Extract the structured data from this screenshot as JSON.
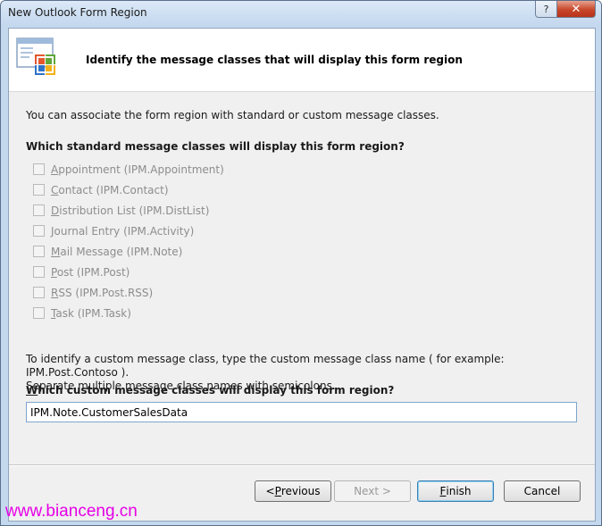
{
  "window": {
    "title": "New Outlook Form Region",
    "help_label": "?",
    "close_label": "✕"
  },
  "header": {
    "title": "Identify the message classes that will display this form region",
    "icon": "form-region-wizard-icon"
  },
  "intro_text": "You can associate the form region with standard or custom message classes.",
  "standard": {
    "question": "Which standard message classes will display this form region?",
    "options": [
      {
        "access": "A",
        "rest": "ppointment (IPM.Appointment)",
        "checked": false,
        "enabled": false
      },
      {
        "access": "C",
        "rest": "ontact (IPM.Contact)",
        "checked": false,
        "enabled": false
      },
      {
        "access": "D",
        "rest": "istribution List (IPM.DistList)",
        "checked": false,
        "enabled": false
      },
      {
        "access": "J",
        "rest": "ournal Entry (IPM.Activity)",
        "checked": false,
        "enabled": false
      },
      {
        "access": "M",
        "rest": "ail Message (IPM.Note)",
        "checked": false,
        "enabled": false
      },
      {
        "access": "P",
        "rest": "ost (IPM.Post)",
        "checked": false,
        "enabled": false
      },
      {
        "access": "R",
        "rest": "SS (IPM.Post.RSS)",
        "checked": false,
        "enabled": false
      },
      {
        "access": "T",
        "rest": "ask (IPM.Task)",
        "checked": false,
        "enabled": false
      }
    ]
  },
  "custom": {
    "help_line1": "To identify a custom message class, type the custom message class name ( for example: IPM.Post.Contoso ).",
    "help_line2": "Separate multiple message class names with semicolons.",
    "question_access": "W",
    "question_rest": "hich custom message classes will display this form region?",
    "value": "IPM.Note.CustomerSalesData"
  },
  "buttons": {
    "previous_prefix": "< ",
    "previous_access": "P",
    "previous_rest": "revious",
    "next_label": "Next >",
    "finish_access": "F",
    "finish_rest": "inish",
    "cancel_label": "Cancel"
  },
  "watermark": "www.bianceng.cn"
}
